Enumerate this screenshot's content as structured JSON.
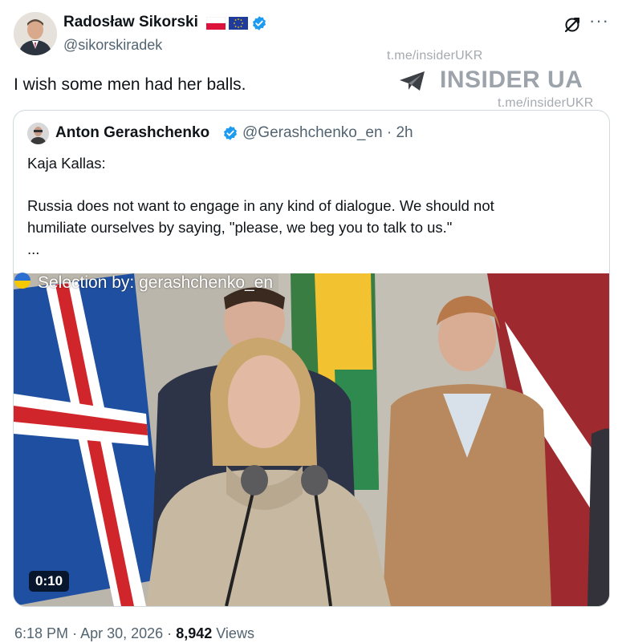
{
  "author": {
    "name": "Radosław Sikorski",
    "handle": "@sikorskiradek",
    "flags": [
      "poland-flag",
      "eu-flag"
    ],
    "verified_icon": "verified-badge-icon"
  },
  "tweet": {
    "text": "I wish some men had her balls."
  },
  "watermark": {
    "link_top": "t.me/insiderUKR",
    "brand": "INSIDER UA",
    "link_bottom": "t.me/insiderUKR"
  },
  "quoted": {
    "name": "Anton Gerashchenko",
    "handle": "@Gerashchenko_en",
    "separator": "·",
    "age": "2h",
    "lines": [
      "Kaja Kallas:",
      "",
      "Russia does not want to engage in any kind of dialogue. We should not",
      "humiliate ourselves by saying, \"please, we beg you to talk to us.\"",
      "..."
    ],
    "video": {
      "overlay_text": "Selection by: gerashchenko_en",
      "duration": "0:10"
    }
  },
  "footer": {
    "time": "6:18 PM",
    "sep1": "·",
    "date": "Apr 30, 2026",
    "sep2": "·",
    "views_count": "8,942",
    "views_label": "Views"
  },
  "colors": {
    "text": "#0f1419",
    "secondary": "#536471",
    "verified": "#1d9bf0",
    "border": "#cfd9de"
  }
}
